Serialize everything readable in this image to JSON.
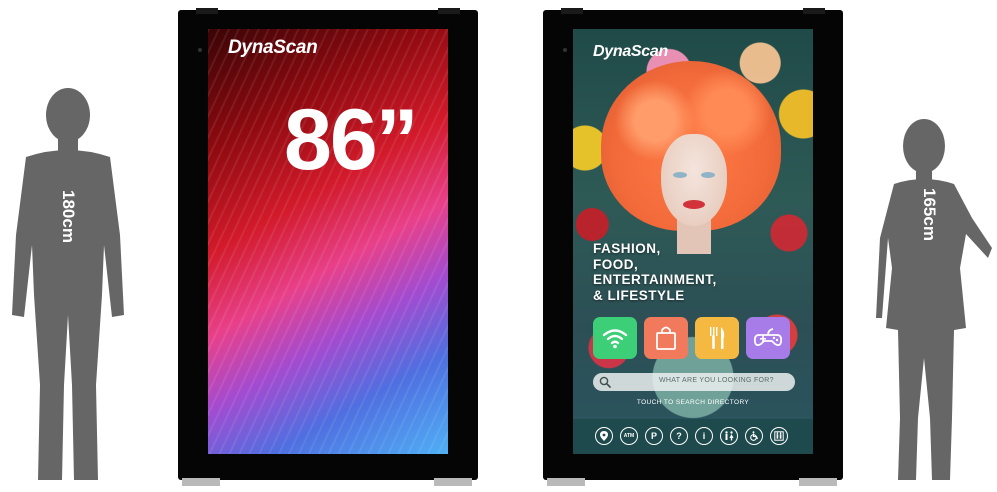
{
  "left_person": {
    "height_label": "180cm"
  },
  "right_person": {
    "height_label": "165cm"
  },
  "left_display": {
    "brand": "DynaScan",
    "size_label": "86”",
    "colors": {
      "deep": "#8f0a10",
      "mid": "#e8408a",
      "light": "#4fb0f5"
    }
  },
  "right_display": {
    "brand": "DynaScan",
    "headline": [
      "FASHION,",
      "FOOD,",
      "ENTERTAINMENT,",
      "& LIFESTYLE"
    ],
    "category_tiles": [
      {
        "icon": "wifi-icon",
        "color": "#3ccf78"
      },
      {
        "icon": "shopping-bag-icon",
        "color": "#f27a5c"
      },
      {
        "icon": "fork-knife-icon",
        "color": "#f5b942"
      },
      {
        "icon": "gamepad-icon",
        "color": "#a77be8"
      }
    ],
    "search": {
      "placeholder": "WHAT ARE YOU LOOKING FOR?"
    },
    "touch_hint": "TOUCH TO SEARCH DIRECTORY",
    "amenities": [
      {
        "icon": "location-pin-icon",
        "label": ""
      },
      {
        "icon": "atm-icon",
        "label": "ATM"
      },
      {
        "icon": "parking-icon",
        "label": "P"
      },
      {
        "icon": "help-icon",
        "label": "?"
      },
      {
        "icon": "info-icon",
        "label": "i"
      },
      {
        "icon": "restroom-icon",
        "label": ""
      },
      {
        "icon": "accessibility-icon",
        "label": ""
      },
      {
        "icon": "elevator-icon",
        "label": ""
      }
    ]
  }
}
